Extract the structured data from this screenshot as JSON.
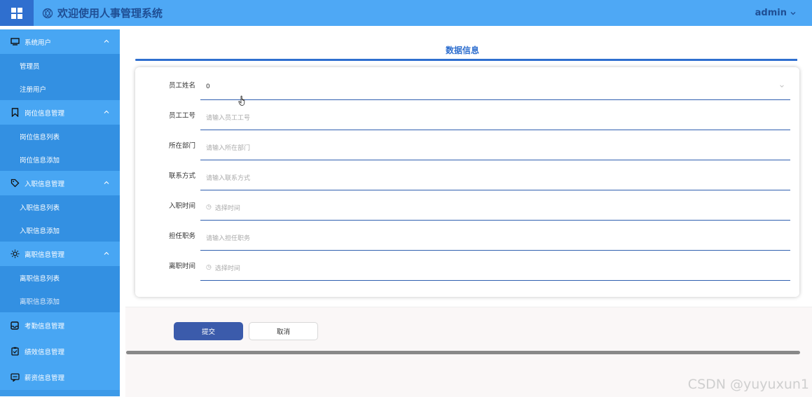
{
  "header": {
    "title": "欢迎使用人事管理系统",
    "user": "admin"
  },
  "sidebar": {
    "groups": [
      {
        "label": "系统用户",
        "icon": "monitor-icon",
        "items": [
          "管理员",
          "注册用户"
        ]
      },
      {
        "label": "岗位信息管理",
        "icon": "bookmark-icon",
        "items": [
          "岗位信息列表",
          "岗位信息添加"
        ]
      },
      {
        "label": "入职信息管理",
        "icon": "tag-icon",
        "items": [
          "入职信息列表",
          "入职信息添加"
        ]
      },
      {
        "label": "离职信息管理",
        "icon": "sun-icon",
        "items": [
          "离职信息列表",
          "离职信息添加"
        ]
      },
      {
        "label": "考勤信息管理",
        "icon": "inbox-icon",
        "items": []
      },
      {
        "label": "绩效信息管理",
        "icon": "clipboard-icon",
        "items": []
      },
      {
        "label": "薪资信息管理",
        "icon": "chat-icon",
        "items": []
      }
    ]
  },
  "main": {
    "tab_title": "数据信息",
    "form": [
      {
        "label": "员工姓名",
        "value": "0",
        "placeholder": ""
      },
      {
        "label": "员工工号",
        "value": "",
        "placeholder": "请输入员工工号"
      },
      {
        "label": "所在部门",
        "value": "",
        "placeholder": "请输入所在部门"
      },
      {
        "label": "联系方式",
        "value": "",
        "placeholder": "请输入联系方式"
      },
      {
        "label": "入职时间",
        "value": "",
        "placeholder": "选择时间"
      },
      {
        "label": "担任职务",
        "value": "",
        "placeholder": "请输入担任职务"
      },
      {
        "label": "离职时间",
        "value": "",
        "placeholder": "选择时间"
      }
    ],
    "submit_label": "提交",
    "cancel_label": "取消"
  },
  "watermark": "CSDN @yuyuxun1",
  "colors": {
    "header": "#4ea8f5",
    "sidebar": "#3d9ae8",
    "accent": "#2f6fcf",
    "submit": "#3b5bab"
  }
}
